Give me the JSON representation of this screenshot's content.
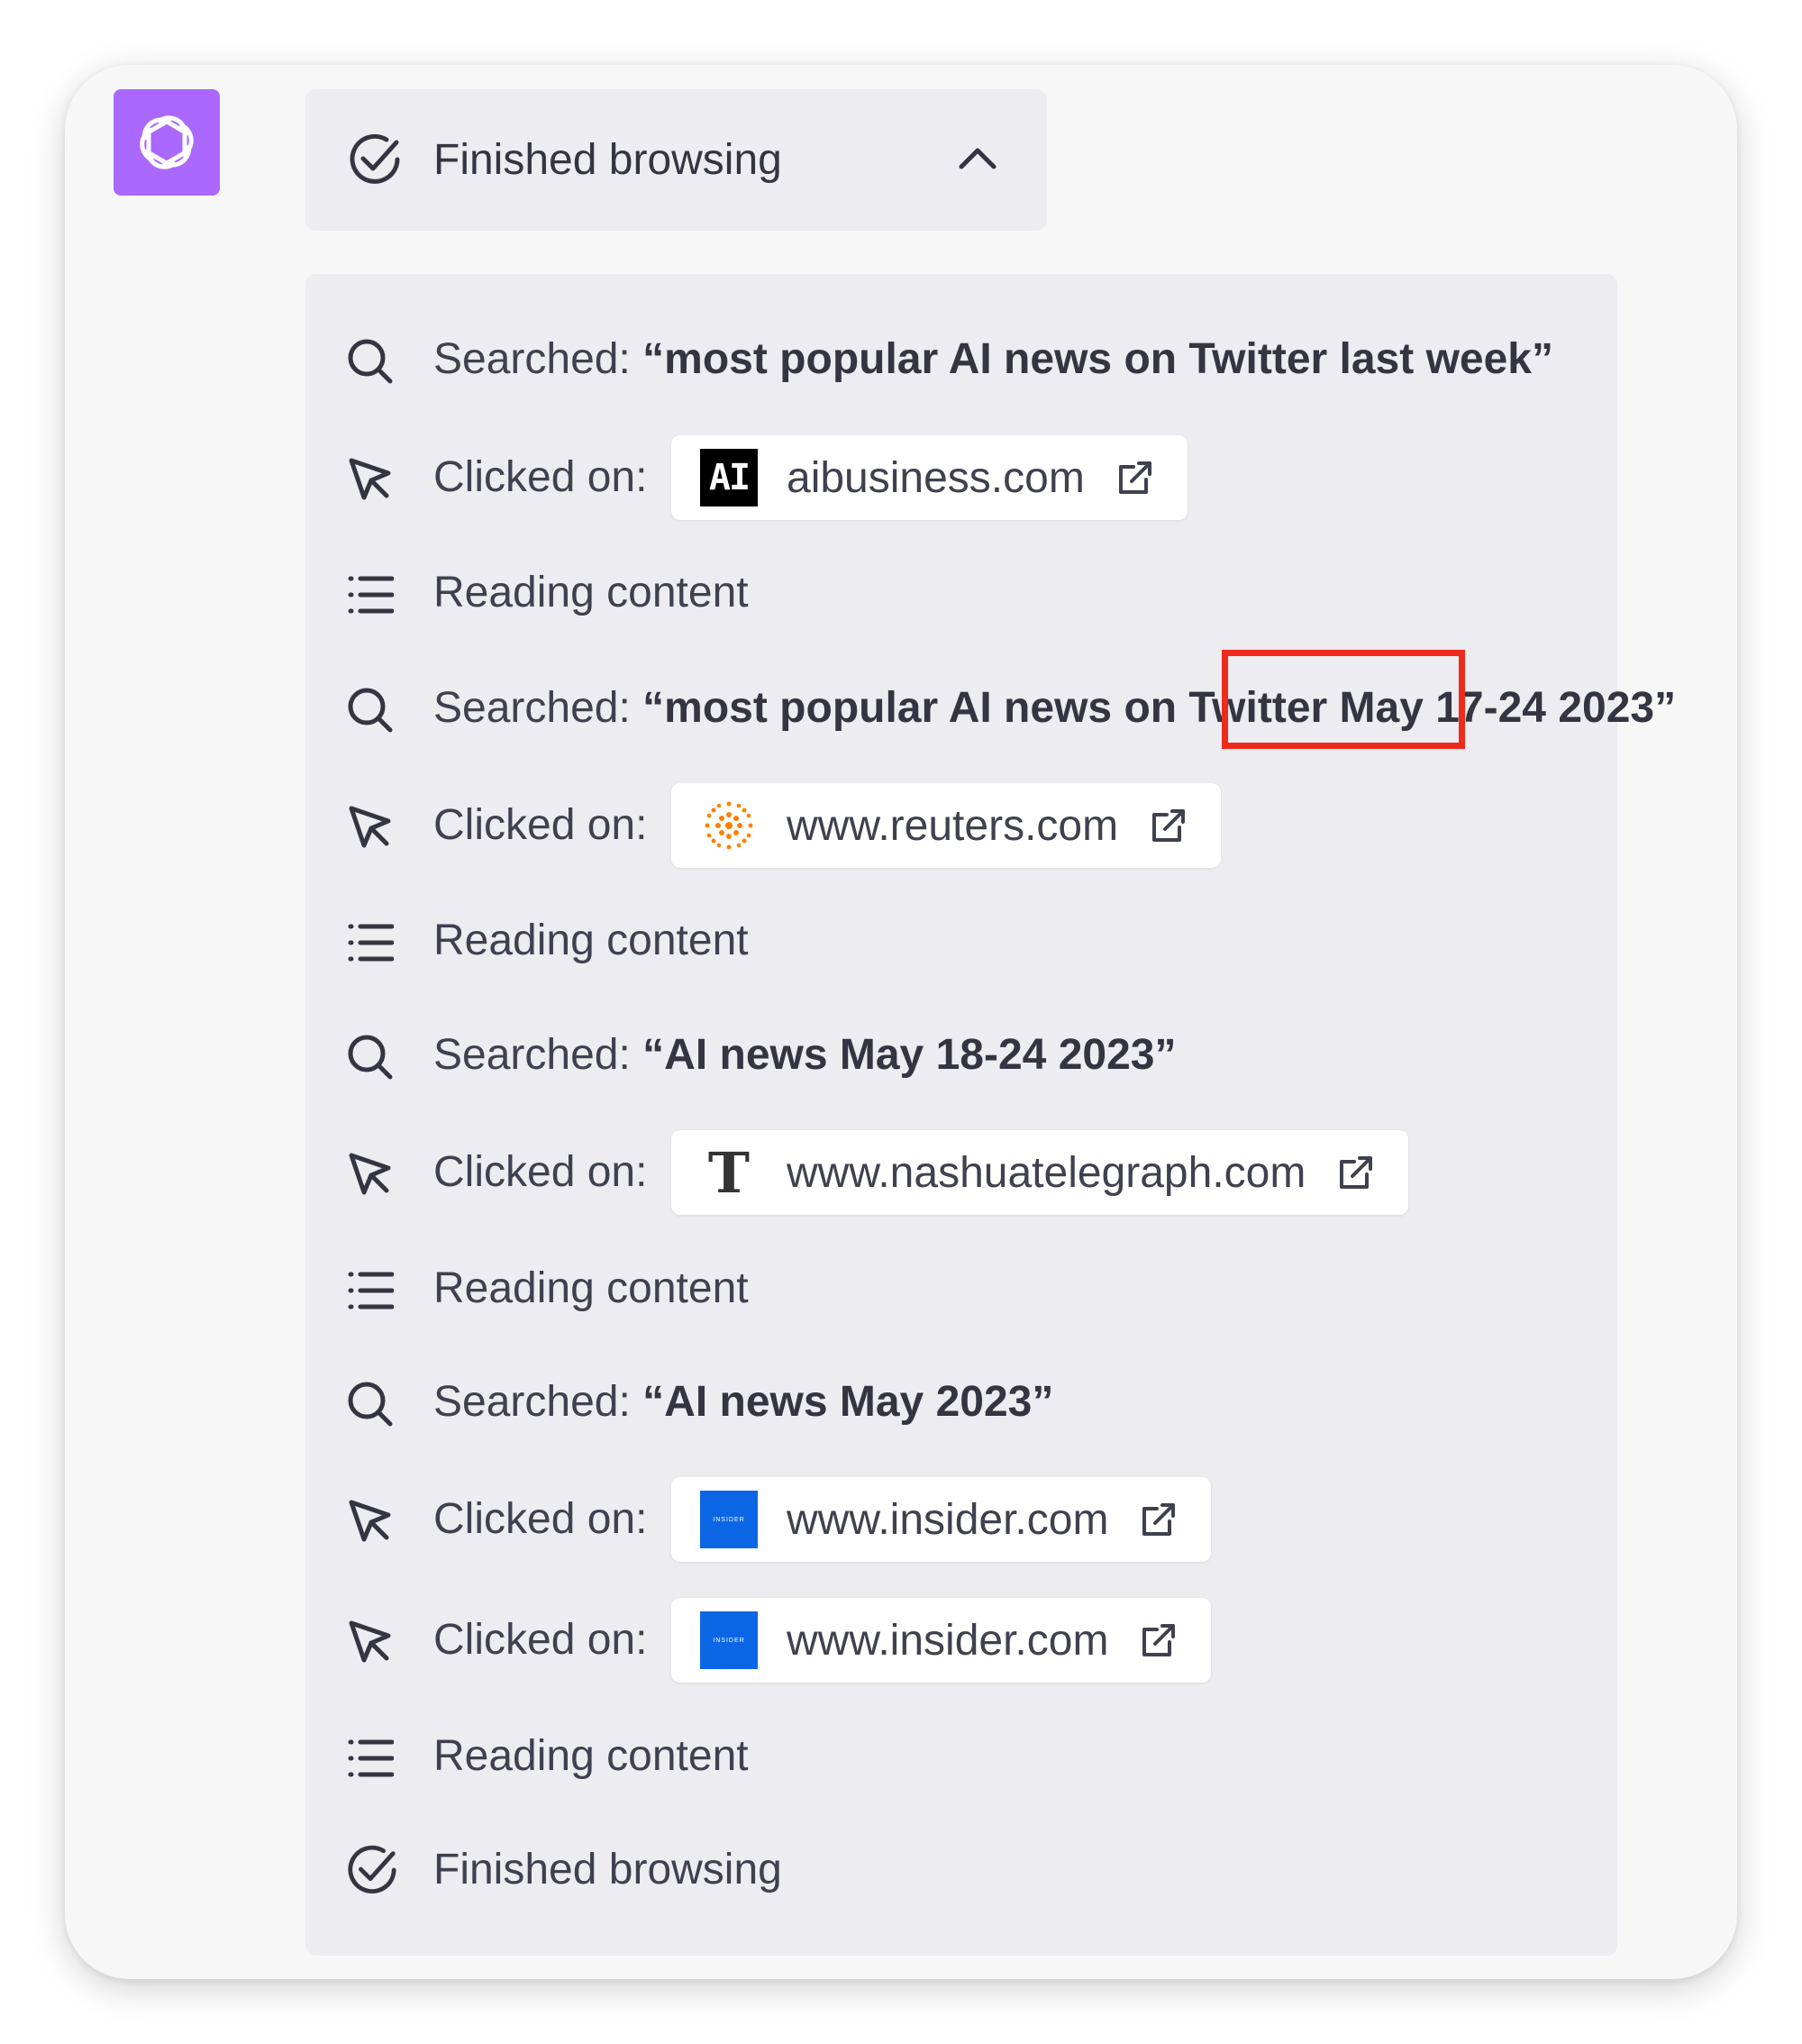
{
  "header": {
    "title": "Finished browsing"
  },
  "steps": [
    {
      "type": "search",
      "label": "Searched:",
      "query": "“most popular AI news on Twitter last week”"
    },
    {
      "type": "click",
      "label": "Clicked on:",
      "url": "aibusiness.com",
      "favicon": "AI"
    },
    {
      "type": "read",
      "label": "Reading content"
    },
    {
      "type": "search",
      "label": "Searched:",
      "query": "“most popular AI news on Twitter May 17-24 2023”"
    },
    {
      "type": "click",
      "label": "Clicked on:",
      "url": "www.reuters.com"
    },
    {
      "type": "read",
      "label": "Reading content"
    },
    {
      "type": "search",
      "label": "Searched:",
      "query": "“AI news May 18-24 2023”"
    },
    {
      "type": "click",
      "label": "Clicked on:",
      "url": "www.nashuatelegraph.com",
      "favicon": "T"
    },
    {
      "type": "read",
      "label": "Reading content"
    },
    {
      "type": "search",
      "label": "Searched:",
      "query": "“AI news May 2023”"
    },
    {
      "type": "click",
      "label": "Clicked on:",
      "url": "www.insider.com",
      "favicon": "INSIDER"
    },
    {
      "type": "click",
      "label": "Clicked on:",
      "url": "www.insider.com",
      "favicon": "INSIDER"
    },
    {
      "type": "read",
      "label": "Reading content"
    },
    {
      "type": "finished",
      "label": "Finished browsing"
    }
  ],
  "colors": {
    "logo_bg": "#ab68ff",
    "highlight": "#ee2b1a",
    "panel_bg": "#ececf1",
    "insider_blue": "#0a66e4",
    "reuters_orange": "#ff8000"
  }
}
